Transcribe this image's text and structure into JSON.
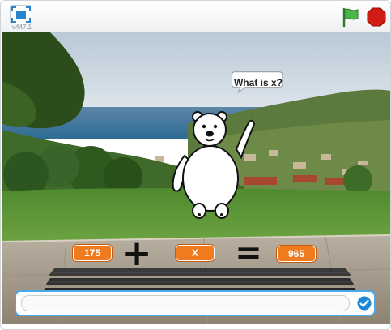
{
  "player": {
    "version": "v447.1",
    "fullscreen_icon": "fullscreen-icon",
    "green_flag_icon": "green-flag-icon",
    "stop_icon": "stop-sign-icon"
  },
  "stage": {
    "speech_bubble": "What is x?",
    "equation": {
      "left_value": "175",
      "plus_symbol": "+",
      "unknown": "X",
      "equals_symbol": "=",
      "right_value": "965"
    },
    "ask_input": {
      "value": "",
      "placeholder": ""
    },
    "submit_icon": "checkmark-icon"
  },
  "colors": {
    "accent_blue": "#4aa8e8",
    "pill_orange": "#f07b1f",
    "flag_green": "#4cb748",
    "stop_red": "#d21b12"
  }
}
